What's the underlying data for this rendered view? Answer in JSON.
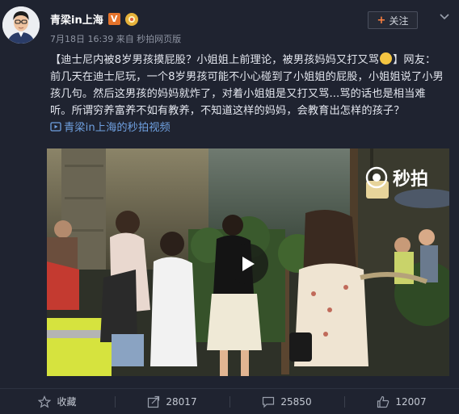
{
  "author": {
    "name": "青梁in上海",
    "verified_badge": "V",
    "meta": "7月18日 16:39 来自 秒拍网页版"
  },
  "follow_button": {
    "icon": "plus-icon",
    "label": "关注"
  },
  "post": {
    "text_segments": [
      "【迪士尼内被8岁男孩摸屁股？小姐姐上前理论，被男孩妈妈又打又骂",
      "】网友：前几天在迪士尼玩，一个8岁男孩可能不小心碰到了小姐姐的屁股，小姐姐说了小男孩几句。然后这男孩的妈妈就炸了，对着小姐姐是又打又骂...骂的话也是相当难听。所谓穷养富养不如有教养，不知道这样的妈妈，会教育出怎样的孩子？"
    ],
    "video_link": "青梁in上海的秒拍视频"
  },
  "video": {
    "watermark": "秒拍"
  },
  "footer": {
    "favorite_label": "收藏",
    "share_count": "28017",
    "comment_count": "25850",
    "like_count": "12007"
  },
  "colors": {
    "background": "#1f2330",
    "link": "#6fa0e0",
    "accent": "#ff8140"
  }
}
